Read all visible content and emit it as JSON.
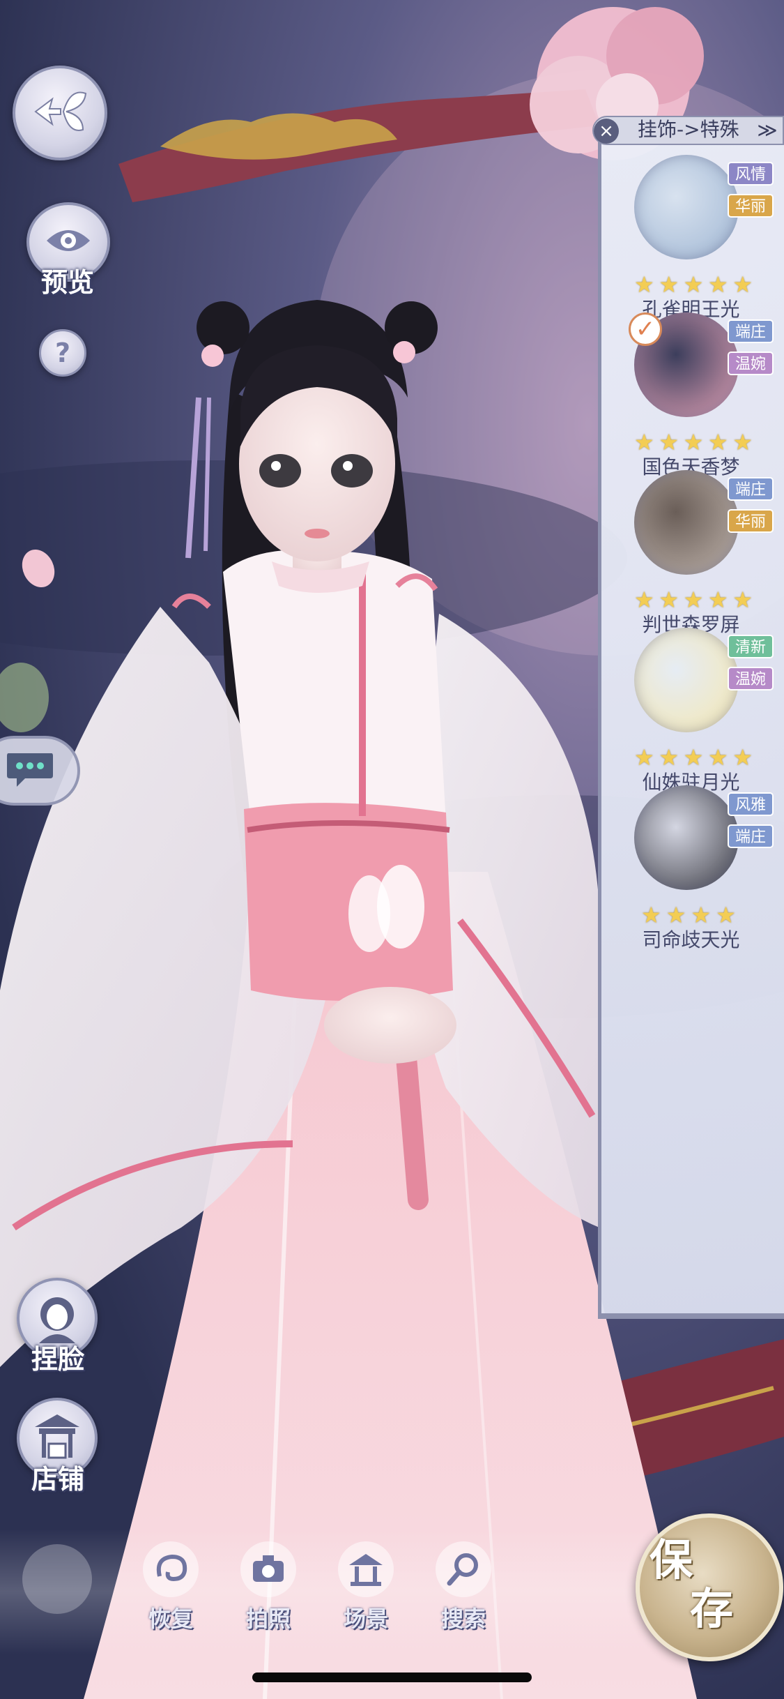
{
  "left_controls": {
    "back_icon": "butterfly-back-icon",
    "preview_label": "预览",
    "help_label": "?",
    "chat_icon": "chat-bubble-icon",
    "face_label": "捏脸",
    "shop_label": "店铺"
  },
  "panel": {
    "title": "挂饰->特殊",
    "close_glyph": "×",
    "toggle_glyph": "≫",
    "items": [
      {
        "name": "孔雀明王光",
        "tags": [
          "风情",
          "华丽"
        ],
        "stars": 5,
        "selected": false
      },
      {
        "name": "国色天香梦",
        "tags": [
          "端庄",
          "温婉"
        ],
        "stars": 5,
        "selected": true
      },
      {
        "name": "判世森罗屏",
        "tags": [
          "端庄",
          "华丽"
        ],
        "stars": 5,
        "selected": false
      },
      {
        "name": "仙姝驻月光",
        "tags": [
          "清新",
          "温婉"
        ],
        "stars": 5,
        "selected": false
      },
      {
        "name": "司命歧天光",
        "tags": [
          "风雅",
          "端庄"
        ],
        "stars": 4,
        "selected": false
      }
    ]
  },
  "tag_colors": {
    "风情": "#8c86c6",
    "华丽": "#d9a64a",
    "端庄": "#7f98cf",
    "温婉": "#b68ac8",
    "清新": "#6fbf9a",
    "风雅": "#7f98cf"
  },
  "toolbar": {
    "restore_label": "恢复",
    "photo_label": "拍照",
    "scene_label": "场景",
    "search_label": "搜索"
  },
  "save": {
    "char1": "保",
    "char2": "存"
  }
}
